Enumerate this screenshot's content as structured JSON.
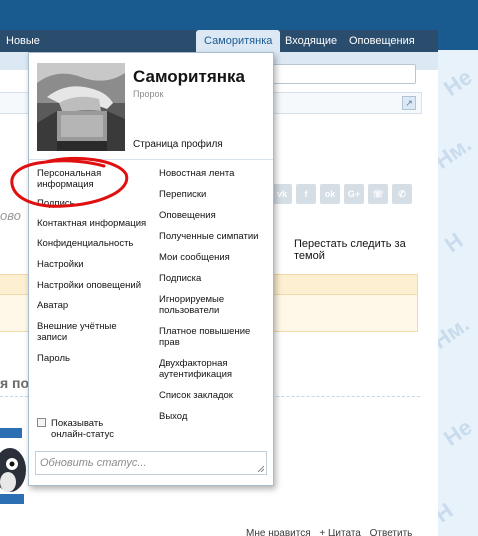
{
  "nav": {
    "left_fragment": "Новые",
    "tabs": [
      {
        "label": "Саморитянка",
        "active": true
      },
      {
        "label": "Входящие",
        "active": false
      },
      {
        "label": "Оповещения",
        "active": false
      }
    ]
  },
  "page": {
    "left_italic": "ово",
    "unfollow": "Перестать следить за темой",
    "partial_title": "я по",
    "post_actions": {
      "like": "Мне нравится",
      "quote": "+ Цитата",
      "reply": "Ответить"
    },
    "share_icons": [
      "vk-icon",
      "facebook-icon",
      "odnoklassniki-icon",
      "google-plus-icon",
      "viber-icon",
      "whatsapp-icon"
    ],
    "share_labels": [
      "vk",
      "f",
      "ok",
      "G+",
      "☏",
      "✆"
    ],
    "watermark": [
      "Не",
      "Нм.",
      "Н"
    ]
  },
  "dropdown": {
    "name": "Саморитянка",
    "rank": "Пророк",
    "profile_link": "Страница профиля",
    "left_menu": [
      "Персональная информация",
      "Подпись",
      "Контактная информация",
      "Конфиденциальность",
      "Настройки",
      "Настройки оповещений",
      "Аватар",
      "Внешние учётные записи",
      "Пароль",
      "Показывать онлайн-статус"
    ],
    "right_menu": [
      "Новостная лента",
      "Переписки",
      "Оповещения",
      "Полученные симпатии",
      "Мои сообщения",
      "Подписка",
      "Игнорируемые пользователи",
      "Платное повышение прав",
      "Двухфакторная аутентификация",
      "Список закладок",
      "Выход"
    ],
    "status_placeholder": "Обновить статус..."
  },
  "colors": {
    "header": "#1a5b8f",
    "nav": "#2a4d6e",
    "active_tab": "#dce9f5",
    "highlight": "#e01010"
  }
}
